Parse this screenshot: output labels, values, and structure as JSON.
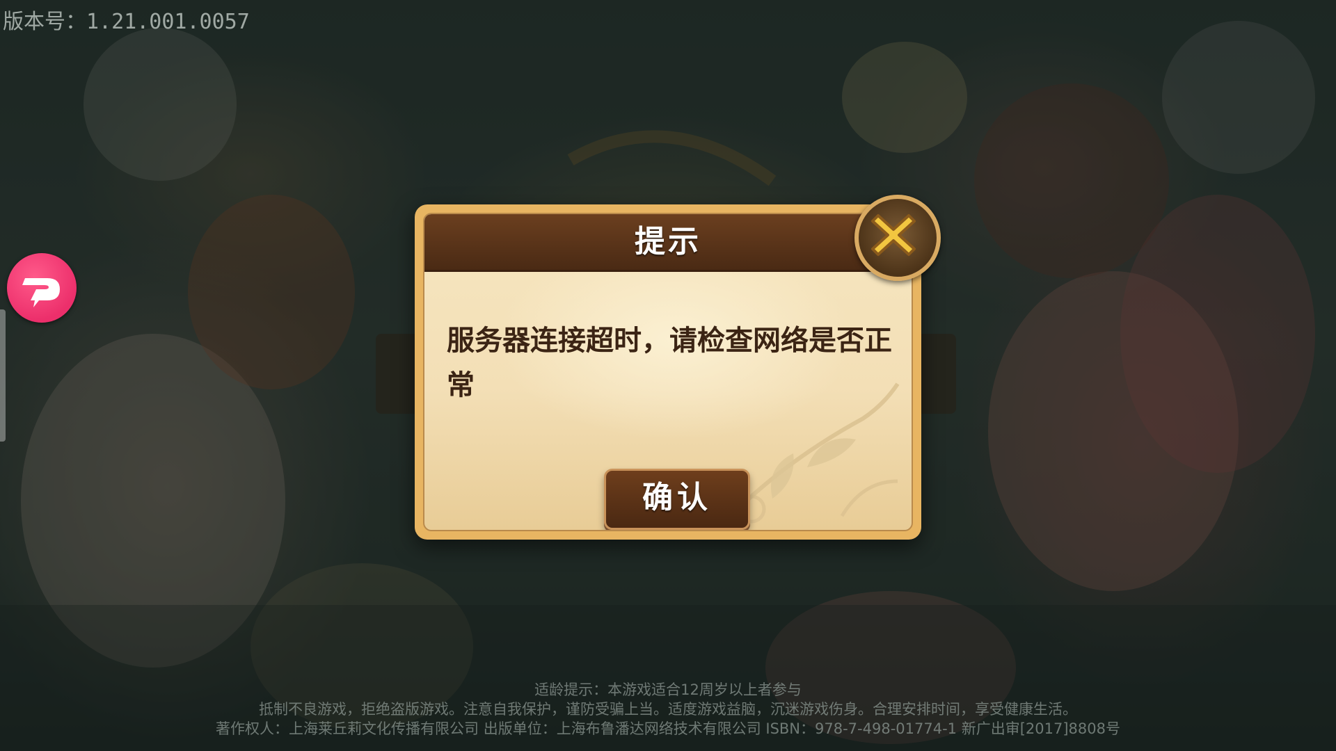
{
  "version": "版本号：1.21.001.0057",
  "dialog": {
    "title": "提示",
    "message": "服务器连接超时，请检查网络是否正常",
    "confirm_label": "确认"
  },
  "footer": {
    "age_notice": "适龄提示：本游戏适合12周岁以上者参与",
    "health_notice": "抵制不良游戏，拒绝盗版游戏。注意自我保护，谨防受骗上当。适度游戏益脑，沉迷游戏伤身。合理安排时间，享受健康生活。",
    "copyright": "著作权人：上海莱丘莉文化传播有限公司  出版单位：上海布鲁潘达网络技术有限公司  ISBN：978-7-498-01774-1  新广出审[2017]8808号"
  },
  "icons": {
    "taptap": "taptap-logo-icon",
    "close": "close-x-icon"
  },
  "colors": {
    "dialog_frame": "#e8b562",
    "title_bar": "#5a331a",
    "message_text": "#3b2414",
    "close_x": "#f2c640",
    "taptap": "#ec2f6b"
  }
}
